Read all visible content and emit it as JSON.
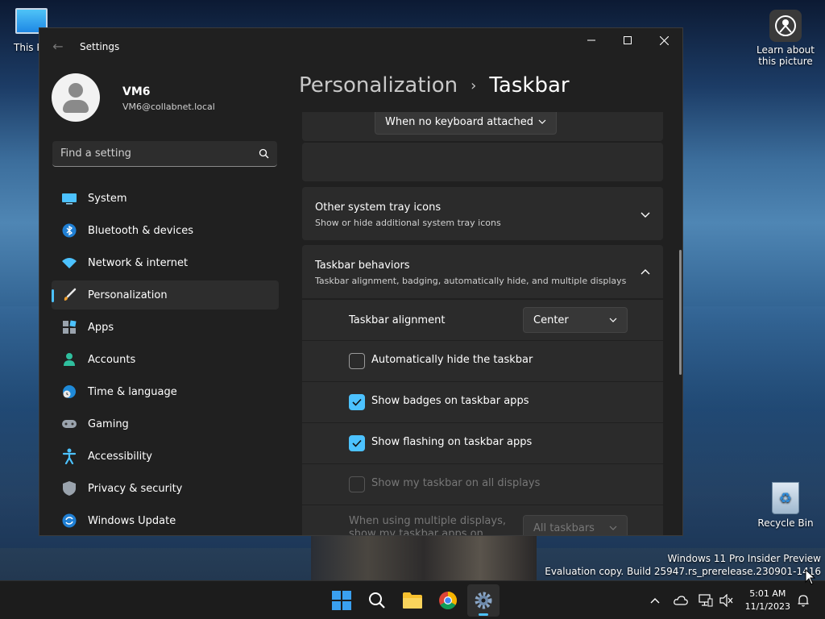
{
  "desktop": {
    "this_pc_label": "This PC",
    "learn_label_line1": "Learn about",
    "learn_label_line2": "this picture",
    "recycle_bin_label": "Recycle Bin",
    "watermark_line1": "Windows 11 Pro Insider Preview",
    "watermark_line2": "Evaluation copy. Build 25947.rs_prerelease.230901-1416"
  },
  "window": {
    "title": "Settings",
    "user": {
      "name": "VM6",
      "email": "VM6@collabnet.local"
    },
    "search_placeholder": "Find a setting",
    "nav": [
      {
        "label": "System",
        "icon": "system-icon"
      },
      {
        "label": "Bluetooth & devices",
        "icon": "bluetooth-icon"
      },
      {
        "label": "Network & internet",
        "icon": "wifi-icon"
      },
      {
        "label": "Personalization",
        "icon": "brush-icon",
        "selected": true
      },
      {
        "label": "Apps",
        "icon": "apps-icon"
      },
      {
        "label": "Accounts",
        "icon": "accounts-icon"
      },
      {
        "label": "Time & language",
        "icon": "globe-clock-icon"
      },
      {
        "label": "Gaming",
        "icon": "gamepad-icon"
      },
      {
        "label": "Accessibility",
        "icon": "accessibility-icon"
      },
      {
        "label": "Privacy & security",
        "icon": "shield-icon"
      },
      {
        "label": "Windows Update",
        "icon": "update-icon"
      }
    ],
    "breadcrumb": {
      "parent": "Personalization",
      "separator": "›",
      "current": "Taskbar"
    },
    "content": {
      "keyboard_dropdown_value": "When no keyboard attached",
      "other_tray": {
        "title": "Other system tray icons",
        "subtitle": "Show or hide additional system tray icons"
      },
      "behaviors": {
        "title": "Taskbar behaviors",
        "subtitle": "Taskbar alignment, badging, automatically hide, and multiple displays",
        "alignment_label": "Taskbar alignment",
        "alignment_value": "Center",
        "auto_hide": {
          "label": "Automatically hide the taskbar",
          "checked": false
        },
        "badges": {
          "label": "Show badges on taskbar apps",
          "checked": true
        },
        "flashing": {
          "label": "Show flashing on taskbar apps",
          "checked": true
        },
        "all_displays": {
          "label": "Show my taskbar on all displays",
          "checked": false,
          "disabled": true
        },
        "multi_display_line1": "When using multiple displays,",
        "multi_display_line2": "show my taskbar apps on",
        "multi_display_value": "All taskbars"
      }
    }
  },
  "taskbar": {
    "time": "5:01 AM",
    "date": "11/1/2023"
  },
  "colors": {
    "accent": "#4cc2ff",
    "window_bg": "#202020",
    "card_bg": "#2b2b2b",
    "taskbar_bg": "#1c1c1c"
  }
}
